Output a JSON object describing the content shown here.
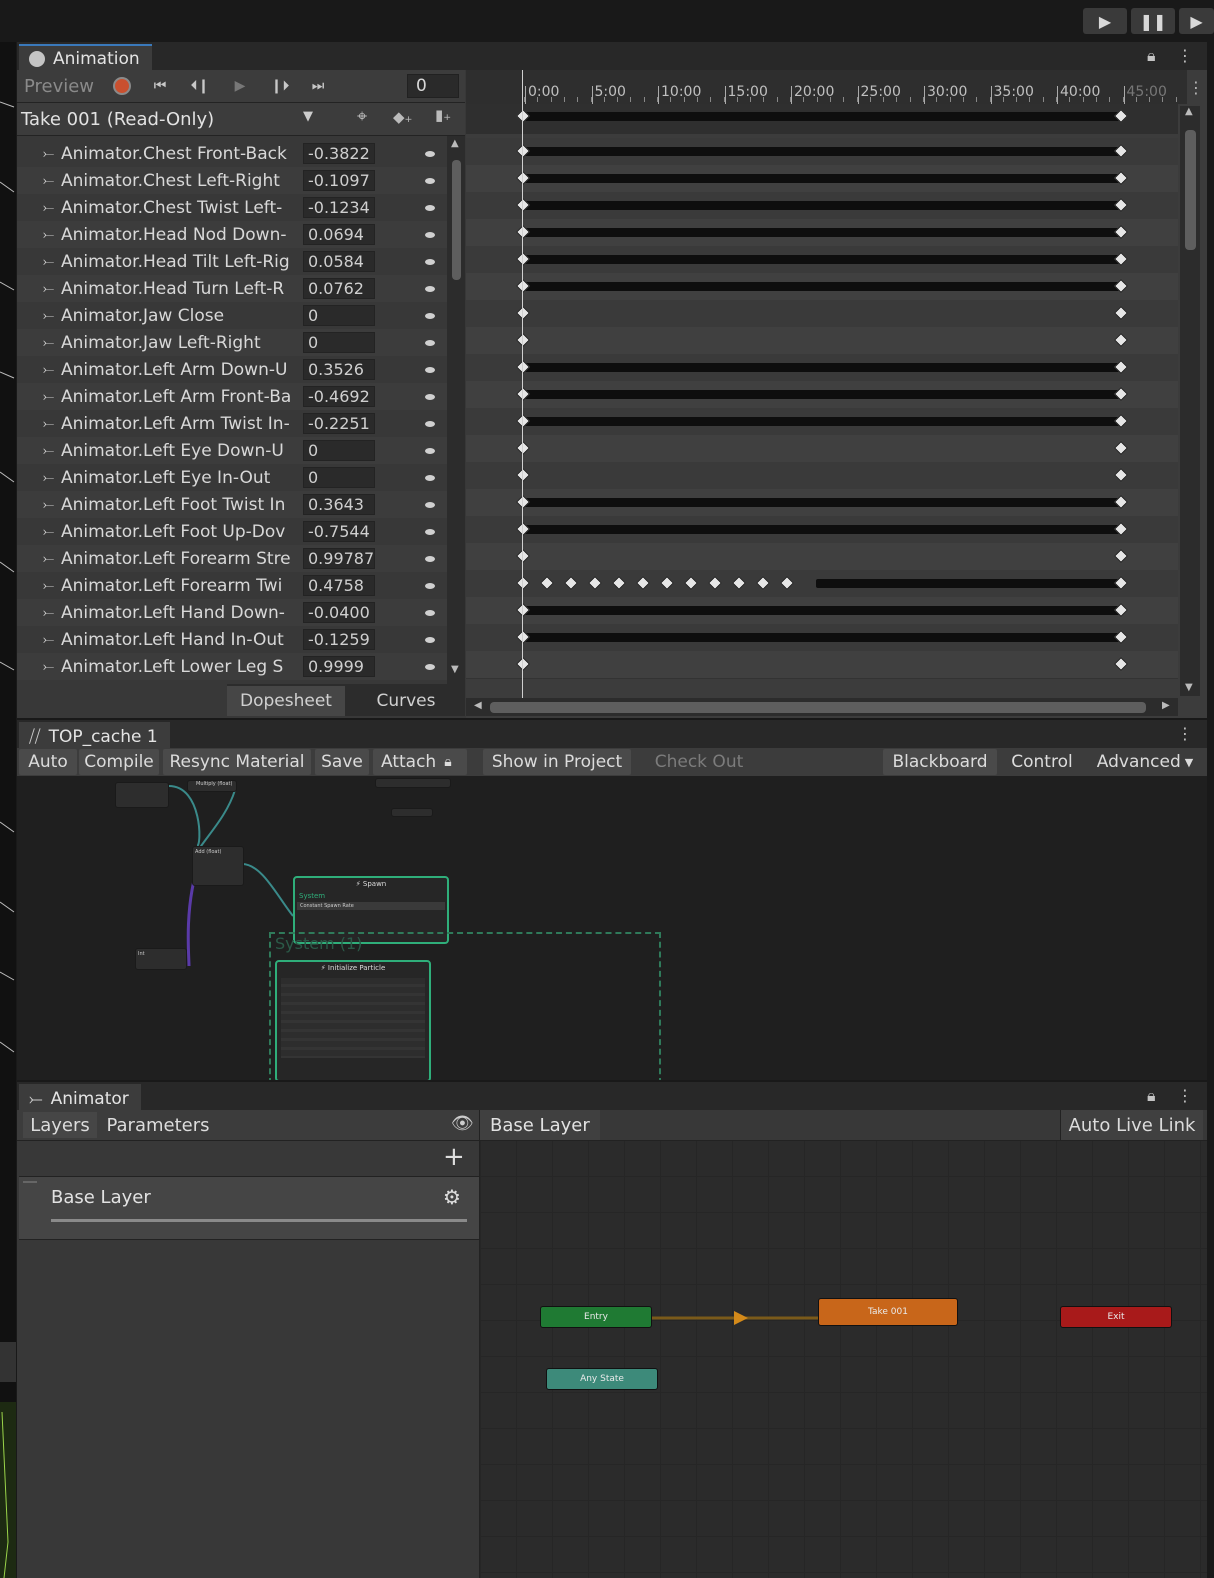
{
  "top_bar": {
    "play_icon": "play-icon",
    "pause_icon": "pause-icon",
    "step_icon": "step-icon"
  },
  "animation": {
    "tab_title": "Animation",
    "preview_label": "Preview",
    "frame_value": "0",
    "clip_name": "Take 001 (Read-Only)",
    "properties": [
      {
        "name": "Animator.Chest Front-Back",
        "value": "-0.3822"
      },
      {
        "name": "Animator.Chest Left-Right",
        "value": "-0.1097"
      },
      {
        "name": "Animator.Chest Twist Left-",
        "value": "-0.1234"
      },
      {
        "name": "Animator.Head Nod Down-",
        "value": "0.0694"
      },
      {
        "name": "Animator.Head Tilt Left-Rig",
        "value": "0.0584"
      },
      {
        "name": "Animator.Head Turn Left-R",
        "value": "0.0762"
      },
      {
        "name": "Animator.Jaw Close",
        "value": "0"
      },
      {
        "name": "Animator.Jaw Left-Right",
        "value": "0"
      },
      {
        "name": "Animator.Left Arm Down-U",
        "value": "0.3526"
      },
      {
        "name": "Animator.Left Arm Front-Ba",
        "value": "-0.4692"
      },
      {
        "name": "Animator.Left Arm Twist In-",
        "value": "-0.2251"
      },
      {
        "name": "Animator.Left Eye Down-U",
        "value": "0"
      },
      {
        "name": "Animator.Left Eye In-Out",
        "value": "0"
      },
      {
        "name": "Animator.Left Foot Twist In",
        "value": "0.3643"
      },
      {
        "name": "Animator.Left Foot Up-Dov",
        "value": "-0.7544"
      },
      {
        "name": "Animator.Left Forearm Stre",
        "value": "0.99787"
      },
      {
        "name": "Animator.Left Forearm Twi",
        "value": "0.4758"
      },
      {
        "name": "Animator.Left Hand Down-",
        "value": "-0.0400"
      },
      {
        "name": "Animator.Left Hand In-Out",
        "value": "-0.1259"
      },
      {
        "name": "Animator.Left Lower Leg S",
        "value": "0.9999"
      }
    ],
    "timeline_ticks": [
      "0:00",
      "5:00",
      "10:00",
      "15:00",
      "20:00",
      "25:00",
      "30:00",
      "35:00",
      "40:00",
      "45:00"
    ],
    "bottom_tabs": [
      "Dopesheet",
      "Curves"
    ]
  },
  "vfx": {
    "tab_title": "TOP_cache 1",
    "toolbar": [
      "Auto",
      "Compile",
      "Resync Material",
      "Save",
      "Attach"
    ],
    "show_in_project": "Show in Project",
    "check_out": "Check Out",
    "right_toolbar": [
      "Blackboard",
      "Control",
      "Advanced"
    ],
    "nodes": {
      "spawn": "Spawn",
      "system_label": "System",
      "constant_rate": "Constant Spawn Rate",
      "init": "Initialize Particle",
      "system_faded": "System (1)",
      "add_float": "Add (float)",
      "multiply_float": "Multiply (float)",
      "int_label": "Int"
    }
  },
  "animator": {
    "tab_title": "Animator",
    "tabs": [
      "Layers",
      "Parameters"
    ],
    "breadcrumb": "Base Layer",
    "auto_live_link": "Auto Live Link",
    "layer_name": "Base Layer",
    "states": {
      "entry": "Entry",
      "take": "Take 001",
      "exit": "Exit",
      "any": "Any State"
    },
    "colors": {
      "entry": "#1f7a33",
      "take": "#c8661a",
      "exit": "#a81a1a",
      "any": "#3d8a7a"
    }
  }
}
